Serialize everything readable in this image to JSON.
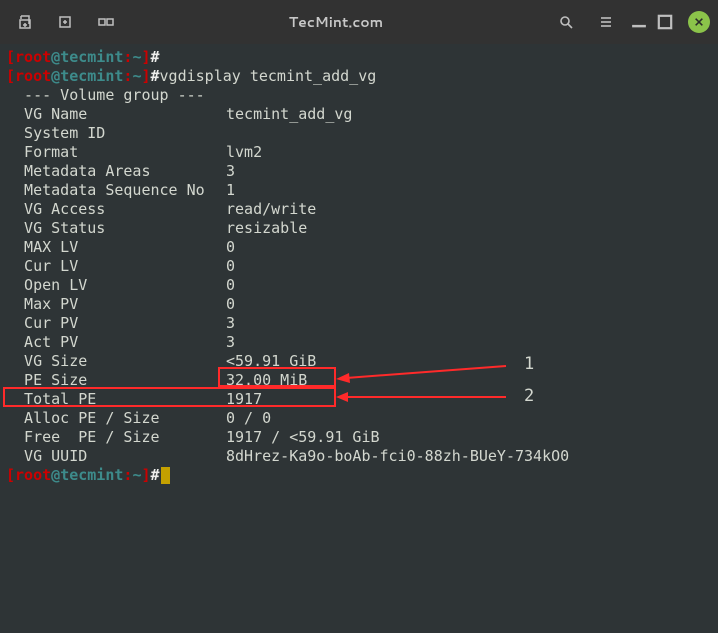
{
  "titlebar": {
    "title": "TecMint.com"
  },
  "prompt": {
    "open": "[",
    "close": "]",
    "user": "root",
    "at": "@",
    "host": "tecmint",
    "colon": ":",
    "path": "~",
    "hash": "#"
  },
  "lines": {
    "cmd1": "vgdisplay tecmint_add_vg",
    "hdr": "  --- Volume group ---",
    "r01k": "  VG Name",
    "r01v": "tecmint_add_vg",
    "r02k": "  System ID",
    "r02v": "",
    "r03k": "  Format",
    "r03v": "lvm2",
    "r04k": "  Metadata Areas",
    "r04v": "3",
    "r05k": "  Metadata Sequence No",
    "r05v": "1",
    "r06k": "  VG Access",
    "r06v": "read/write",
    "r07k": "  VG Status",
    "r07v": "resizable",
    "r08k": "  MAX LV",
    "r08v": "0",
    "r09k": "  Cur LV",
    "r09v": "0",
    "r10k": "  Open LV",
    "r10v": "0",
    "r11k": "  Max PV",
    "r11v": "0",
    "r12k": "  Cur PV",
    "r12v": "3",
    "r13k": "  Act PV",
    "r13v": "3",
    "r14k": "  VG Size",
    "r14v": "<59.91 GiB",
    "r15k": "  PE Size",
    "r15v": "32.00 MiB",
    "r16k": "  Total PE",
    "r16v": "1917",
    "r17k": "  Alloc PE / Size",
    "r17v": "0 / 0",
    "r18k": "  Free  PE / Size",
    "r18v": "1917 / <59.91 GiB",
    "r19k": "  VG UUID",
    "r19v": "8dHrez-Ka9o-boAb-fci0-88zh-BUeY-734kO0",
    "blank": ""
  },
  "anno": {
    "one": "1",
    "two": "2"
  }
}
